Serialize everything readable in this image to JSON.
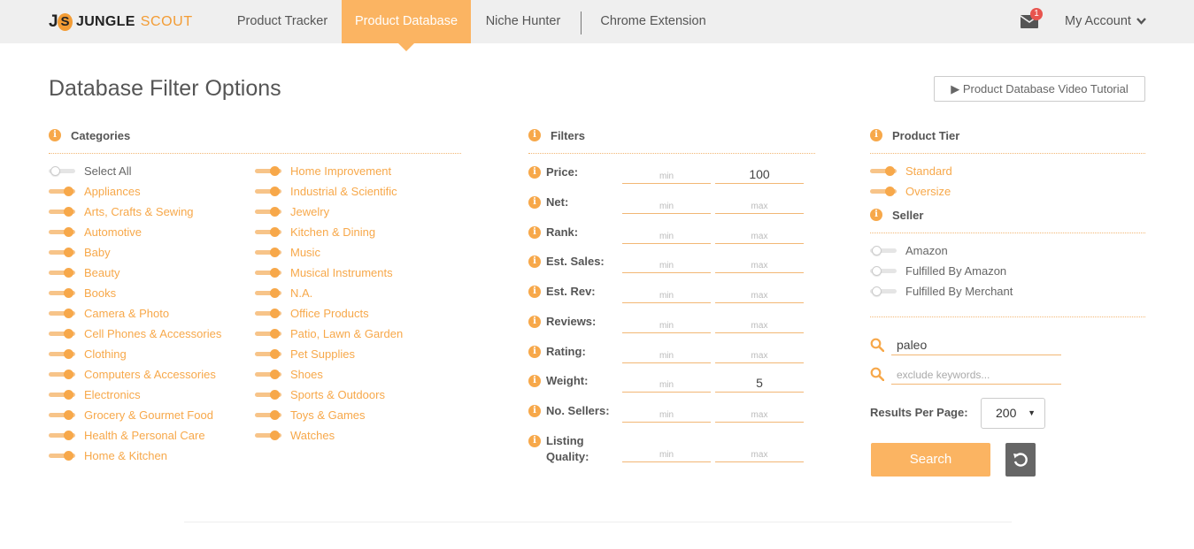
{
  "brand": {
    "logo_j": "J",
    "logo_s": "S",
    "word1": "JUNGLE",
    "word2": "SCOUT"
  },
  "nav": {
    "items": [
      {
        "label": "Product Tracker"
      },
      {
        "label": "Product Database"
      },
      {
        "label": "Niche Hunter"
      },
      {
        "label": "Chrome Extension"
      }
    ],
    "notification_count": "1",
    "account_label": "My Account"
  },
  "page": {
    "title": "Database Filter Options",
    "video_button": "▶ Product Database Video Tutorial"
  },
  "categories": {
    "heading": "Categories",
    "select_all": "Select All",
    "col1": [
      "Appliances",
      "Arts, Crafts & Sewing",
      "Automotive",
      "Baby",
      "Beauty",
      "Books",
      "Camera & Photo",
      "Cell Phones & Accessories",
      "Clothing",
      "Computers & Accessories",
      "Electronics",
      "Grocery & Gourmet Food",
      "Health & Personal Care",
      "Home & Kitchen"
    ],
    "col2": [
      "Home Improvement",
      "Industrial & Scientific",
      "Jewelry",
      "Kitchen & Dining",
      "Music",
      "Musical Instruments",
      "N.A.",
      "Office Products",
      "Patio, Lawn & Garden",
      "Pet Supplies",
      "Shoes",
      "Sports & Outdoors",
      "Toys & Games",
      "Watches"
    ]
  },
  "filters": {
    "heading": "Filters",
    "rows": [
      {
        "label": "Price:",
        "min": "",
        "max": "100"
      },
      {
        "label": "Net:",
        "min": "",
        "max": ""
      },
      {
        "label": "Rank:",
        "min": "",
        "max": ""
      },
      {
        "label": "Est. Sales:",
        "min": "",
        "max": ""
      },
      {
        "label": "Est. Rev:",
        "min": "",
        "max": ""
      },
      {
        "label": "Reviews:",
        "min": "",
        "max": ""
      },
      {
        "label": "Rating:",
        "min": "",
        "max": ""
      },
      {
        "label": "Weight:",
        "min": "",
        "max": "5"
      },
      {
        "label": "No. Sellers:",
        "min": "",
        "max": ""
      },
      {
        "label": "Listing\nQuality:",
        "min": "",
        "max": ""
      }
    ],
    "min_placeholder": "min",
    "max_placeholder": "max"
  },
  "product_tier": {
    "heading": "Product Tier",
    "items": [
      {
        "label": "Standard",
        "on": true
      },
      {
        "label": "Oversize",
        "on": true
      }
    ]
  },
  "seller": {
    "heading": "Seller",
    "items": [
      {
        "label": "Amazon",
        "on": false
      },
      {
        "label": "Fulfilled By Amazon",
        "on": false
      },
      {
        "label": "Fulfilled By Merchant",
        "on": false
      }
    ]
  },
  "keywords": {
    "include_value": "paleo",
    "exclude_value": "",
    "exclude_placeholder": "exclude keywords..."
  },
  "results": {
    "label": "Results Per Page:",
    "selected": "200"
  },
  "actions": {
    "search_label": "Search"
  },
  "colors": {
    "accent": "#fbb462",
    "accent_dark": "#f7a84a",
    "nav_bg": "#efefef",
    "badge": "#e8544e"
  }
}
